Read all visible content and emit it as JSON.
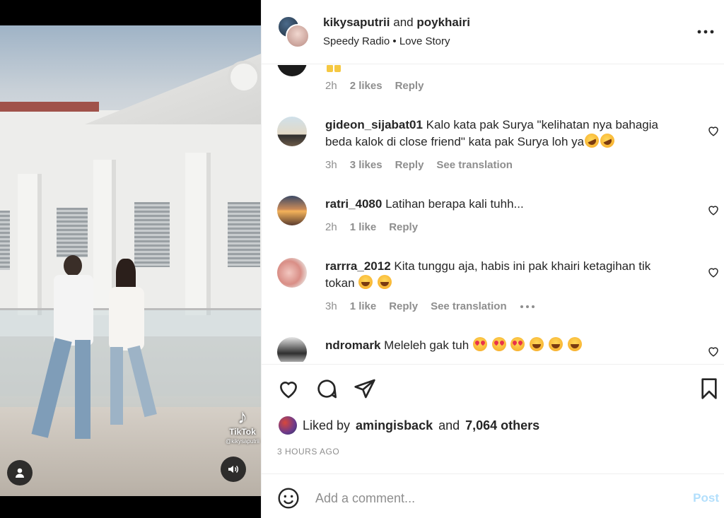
{
  "header": {
    "author1": "kikysaputrii",
    "conjunction": "and",
    "author2": "poykhairi",
    "audio": "Speedy Radio • Love Story",
    "more_icon": "more-horizontal-icon"
  },
  "comments": [
    {
      "user": "",
      "text": "",
      "emojis": [
        "raising-hands"
      ],
      "time": "2h",
      "likes": "2 likes",
      "reply": "Reply"
    },
    {
      "user": "gideon_sijabat01",
      "text": "Kalo kata pak Surya \"kelihatan nya bahagia beda kalok di close friend\" kata pak Surya loh ya",
      "emojis": [
        "rofl",
        "rofl"
      ],
      "time": "3h",
      "likes": "3 likes",
      "reply": "Reply",
      "translation": "See translation"
    },
    {
      "user": "ratri_4080",
      "text": "Latihan berapa kali tuhh...",
      "time": "2h",
      "likes": "1 like",
      "reply": "Reply"
    },
    {
      "user": "rarrra_2012",
      "text": "Kita tunggu aja, habis ini pak khairi ketagihan tik tokan",
      "emojis": [
        "laugh",
        "laugh"
      ],
      "time": "3h",
      "likes": "1 like",
      "reply": "Reply",
      "translation": "See translation"
    },
    {
      "user": "ndromark",
      "text": "Meleleh gak tuh",
      "emojis": [
        "heart-eyes",
        "heart-eyes",
        "heart-eyes",
        "laugh",
        "laugh",
        "laugh"
      ]
    }
  ],
  "media": {
    "watermark_brand": "TikTok",
    "watermark_user": "@kikysaputrii"
  },
  "likes": {
    "prefix": "Liked by",
    "user": "amingisback",
    "and": "and",
    "others": "7,064 others"
  },
  "post_time": "3 HOURS AGO",
  "comment_box": {
    "placeholder": "Add a comment...",
    "post_label": "Post"
  },
  "colors": {
    "text": "#262626",
    "muted": "#8e8e8e",
    "post_disabled": "#b2dffc",
    "divider": "#efefef"
  }
}
